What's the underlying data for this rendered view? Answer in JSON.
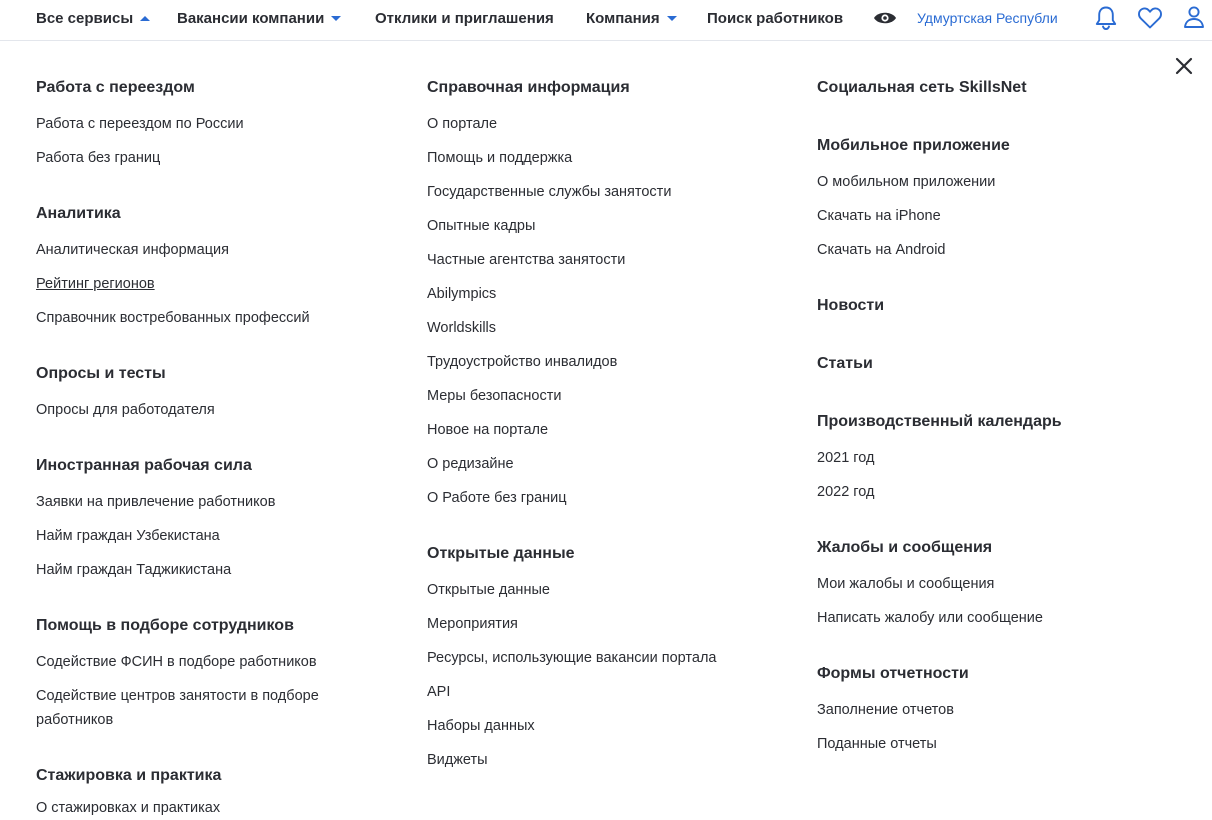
{
  "header": {
    "nav": [
      {
        "label": "Все сервисы",
        "caret": "up"
      },
      {
        "label": "Вакансии компании",
        "caret": "down"
      },
      {
        "label": "Отклики и приглашения"
      },
      {
        "label": "Компания",
        "caret": "down"
      },
      {
        "label": "Поиск работников"
      }
    ],
    "region": "Удмуртская Республика",
    "icons": [
      "eye-icon",
      "bell-icon",
      "heart-icon",
      "user-icon",
      "close-icon"
    ]
  },
  "colors": {
    "accent": "#2a6bd3",
    "text": "#2b2d33",
    "divider": "#e3e6ec"
  },
  "menu": {
    "col1": [
      {
        "title": "Работа с переездом",
        "links": [
          "Работа с переездом по России",
          "Работа без границ"
        ]
      },
      {
        "title": "Аналитика",
        "links": [
          "Аналитическая информация",
          "Рейтинг регионов",
          "Справочник востребованных профессий"
        ]
      },
      {
        "title": "Опросы и тесты",
        "links": [
          "Опросы для работодателя"
        ]
      },
      {
        "title": "Иностранная рабочая сила",
        "links": [
          "Заявки на привлечение работников",
          "Найм граждан Узбекистана",
          "Найм граждан Таджикистана"
        ]
      },
      {
        "title": "Помощь в подборе сотрудников",
        "links": [
          "Содействие ФСИН в подборе работников",
          "Содействие центров занятости в подборе работников"
        ]
      },
      {
        "title": "Стажировка и практика",
        "links": [
          "О стажировках и практиках"
        ]
      }
    ],
    "col2": [
      {
        "title": "Справочная информация",
        "links": [
          "О портале",
          "Помощь и поддержка",
          "Государственные службы занятости",
          "Опытные кадры",
          "Частные агентства занятости",
          "Abilympics",
          "Worldskills",
          "Трудоустройство инвалидов",
          "Меры безопасности",
          "Новое на портале",
          "О редизайне",
          "О Работе без границ"
        ]
      },
      {
        "title": "Открытые данные",
        "links": [
          "Открытые данные",
          "Мероприятия",
          "Ресурсы, использующие вакансии портала",
          "API",
          "Наборы данных",
          "Виджеты"
        ]
      }
    ],
    "col3": [
      {
        "title": "Социальная сеть SkillsNet",
        "links": []
      },
      {
        "title": "Мобильное приложение",
        "links": [
          "О мобильном приложении",
          "Скачать на iPhone",
          "Скачать на Android"
        ]
      },
      {
        "title": "Новости",
        "links": []
      },
      {
        "title": "Статьи",
        "links": []
      },
      {
        "title": "Производственный календарь",
        "links": [
          "2021 год",
          "2022 год"
        ]
      },
      {
        "title": "Жалобы и сообщения",
        "links": [
          "Мои жалобы и сообщения",
          "Написать жалобу или сообщение"
        ]
      },
      {
        "title": "Формы отчетности",
        "links": [
          "Заполнение отчетов",
          "Поданные отчеты"
        ]
      }
    ]
  }
}
